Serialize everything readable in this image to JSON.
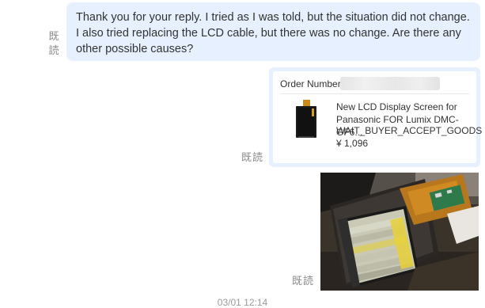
{
  "messages": {
    "text_message": {
      "body": "Thank you for your reply. I tried as I was told, but the situation did not change. I also tried replacing the LCD cable, but there was no change. Are there any other possible causes?",
      "read_line1": "既",
      "read_line2": "読"
    },
    "order_message": {
      "order_label": "Order Number",
      "product_title": "New LCD Display Screen for Panasonic FOR Lumix DMC-GF6...",
      "status": "WAIT_BUYER_ACCEPT_GOODS",
      "price": "¥ 1,096",
      "read": "既読"
    },
    "photo_message": {
      "read": "既読"
    },
    "timestamp": "03/01 12:14"
  }
}
